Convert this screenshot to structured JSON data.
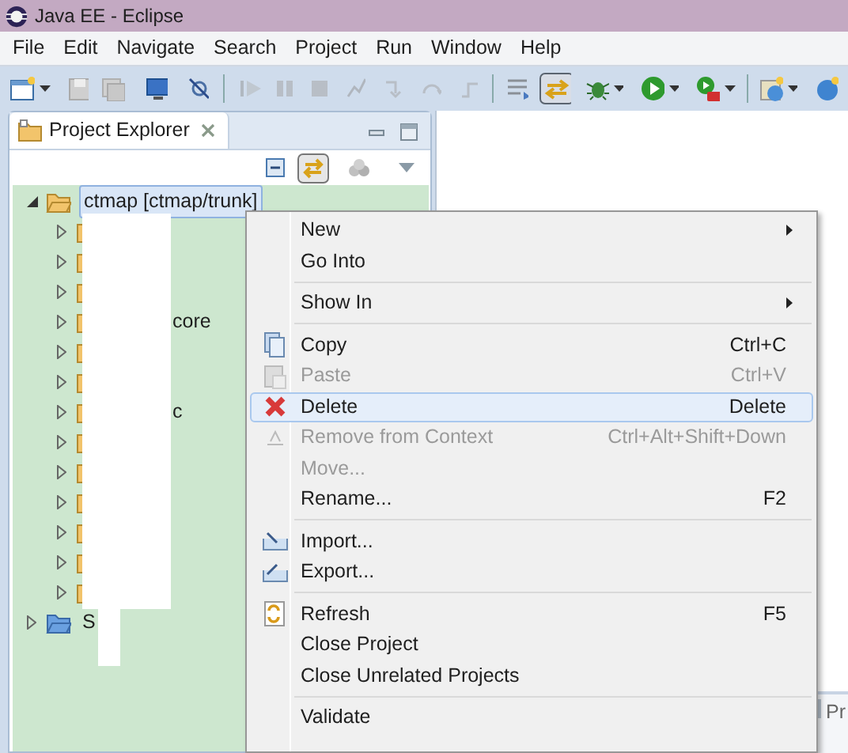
{
  "window": {
    "title": "Java EE - Eclipse"
  },
  "menu_bar": [
    {
      "label": "File"
    },
    {
      "label": "Edit"
    },
    {
      "label": "Navigate"
    },
    {
      "label": "Search"
    },
    {
      "label": "Project"
    },
    {
      "label": "Run"
    },
    {
      "label": "Window"
    },
    {
      "label": "Help"
    }
  ],
  "project_explorer": {
    "tab_label": "Project Explorer",
    "tree": [
      {
        "label": "ctmap [ctmap/trunk]",
        "expanded": true,
        "selected": true,
        "children": [
          {
            "expanded": false
          },
          {
            "expanded": false
          },
          {
            "expanded": false
          },
          {
            "label": "core",
            "expanded": false
          },
          {
            "expanded": false
          },
          {
            "expanded": false
          },
          {
            "label": "c",
            "expanded": false
          },
          {
            "expanded": false
          },
          {
            "expanded": false
          },
          {
            "expanded": false
          },
          {
            "expanded": false
          },
          {
            "expanded": false
          },
          {
            "expanded": false
          }
        ]
      },
      {
        "label": "S",
        "expanded": false,
        "selected": false
      }
    ]
  },
  "context_menu": [
    {
      "kind": "item",
      "label": "New",
      "submenu": true,
      "disabled": false,
      "selected": false
    },
    {
      "kind": "item",
      "label": "Go Into",
      "disabled": false,
      "selected": false
    },
    {
      "kind": "separator"
    },
    {
      "kind": "item",
      "label": "Show In",
      "submenu": true,
      "disabled": false,
      "selected": false
    },
    {
      "kind": "separator"
    },
    {
      "kind": "item",
      "label": "Copy",
      "shortcut": "Ctrl+C",
      "disabled": false,
      "selected": false
    },
    {
      "kind": "item",
      "label": "Paste",
      "shortcut": "Ctrl+V",
      "disabled": true,
      "selected": false
    },
    {
      "kind": "item",
      "label": "Delete",
      "shortcut": "Delete",
      "disabled": false,
      "selected": true
    },
    {
      "kind": "item",
      "label": "Remove from Context",
      "shortcut": "Ctrl+Alt+Shift+Down",
      "disabled": true,
      "selected": false
    },
    {
      "kind": "item",
      "label": "Move...",
      "disabled": true,
      "selected": false
    },
    {
      "kind": "item",
      "label": "Rename...",
      "shortcut": "F2",
      "disabled": false,
      "selected": false
    },
    {
      "kind": "separator"
    },
    {
      "kind": "item",
      "label": "Import...",
      "disabled": false,
      "selected": false
    },
    {
      "kind": "item",
      "label": "Export...",
      "disabled": false,
      "selected": false
    },
    {
      "kind": "separator"
    },
    {
      "kind": "item",
      "label": "Refresh",
      "shortcut": "F5",
      "disabled": false,
      "selected": false
    },
    {
      "kind": "item",
      "label": "Close Project",
      "disabled": false,
      "selected": false
    },
    {
      "kind": "item",
      "label": "Close Unrelated Projects",
      "disabled": false,
      "selected": false
    },
    {
      "kind": "separator"
    },
    {
      "kind": "item",
      "label": "Validate",
      "disabled": false,
      "selected": false
    }
  ],
  "bottom_panel": {
    "tab_label": "Pr"
  }
}
